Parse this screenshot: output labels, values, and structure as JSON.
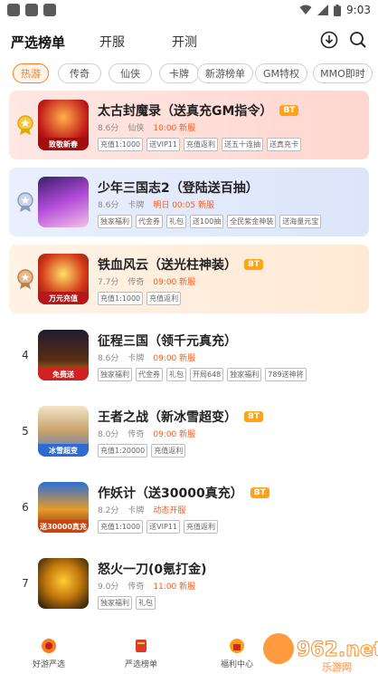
{
  "status_bar": {
    "time": "9:03"
  },
  "header": {
    "tabs": [
      {
        "label": "严选榜单",
        "active": true
      },
      {
        "label": "开服",
        "active": false
      },
      {
        "label": "开测",
        "active": false
      }
    ],
    "icons": [
      "download-icon",
      "search-icon"
    ]
  },
  "filters": [
    {
      "label": "热游",
      "active": true
    },
    {
      "label": "传奇",
      "active": false
    },
    {
      "label": "仙侠",
      "active": false
    },
    {
      "label": "卡牌",
      "active": false
    },
    {
      "label": "新游榜单",
      "active": false
    },
    {
      "label": "GM特权",
      "active": false
    },
    {
      "label": "MMO即时",
      "active": false
    }
  ],
  "games": [
    {
      "rank": "",
      "medal": "gold",
      "title": "太古封魔录（送真充GM指令）",
      "bt": "BT",
      "score": "8.6分",
      "genre": "仙侠",
      "time": "10:00 新服",
      "tags": [
        "充值1:1000",
        "送VIP11",
        "充值返利",
        "送五十连抽",
        "送真充卡"
      ],
      "thumb_caption": "致敬新春"
    },
    {
      "rank": "",
      "medal": "silver",
      "title": "少年三国志2（登陆送百抽）",
      "bt": "",
      "score": "8.6分",
      "genre": "卡牌",
      "time": "明日 00:05 新服",
      "tags": [
        "独家福利",
        "代金券",
        "礼包",
        "送100抽",
        "全民紫金神装",
        "送海量元宝"
      ],
      "thumb_caption": ""
    },
    {
      "rank": "",
      "medal": "bronze",
      "title": "铁血风云（送光柱神装）",
      "bt": "BT",
      "score": "7.7分",
      "genre": "传奇",
      "time": "09:00 新服",
      "tags": [
        "充值1:1000",
        "充值返利"
      ],
      "thumb_caption": "万元充值"
    },
    {
      "rank": "4",
      "medal": "",
      "title": "征程三国（领千元真充）",
      "bt": "",
      "score": "8.6分",
      "genre": "卡牌",
      "time": "09:00 新服",
      "tags": [
        "独家福利",
        "代金券",
        "礼包",
        "开局648",
        "独家福利",
        "789送神将"
      ],
      "thumb_caption": "免费送"
    },
    {
      "rank": "5",
      "medal": "",
      "title": "王者之战（新冰雪超变）",
      "bt": "BT",
      "score": "8.0分",
      "genre": "传奇",
      "time": "09:00 新服",
      "tags": [
        "充值1:20000",
        "充值返利"
      ],
      "thumb_caption": "冰雪超变"
    },
    {
      "rank": "6",
      "medal": "",
      "title": "作妖计（送30000真充）",
      "bt": "BT",
      "score": "8.2分",
      "genre": "卡牌",
      "time": "动态开服",
      "tags": [
        "充值1:1000",
        "送VIP11",
        "充值返利"
      ],
      "thumb_caption": "送30000真充"
    },
    {
      "rank": "7",
      "medal": "",
      "title": "怒火一刀(0氪打金)",
      "bt": "",
      "score": "9.0分",
      "genre": "传奇",
      "time": "11:00 新服",
      "tags": [
        "独家福利",
        "礼包"
      ],
      "thumb_caption": ""
    }
  ],
  "bottom_nav": [
    {
      "label": "好游严选",
      "icon": "home-icon"
    },
    {
      "label": "严选榜单",
      "icon": "ranking-icon"
    },
    {
      "label": "福利中心",
      "icon": "gift-icon"
    }
  ],
  "watermark": {
    "text": "962.net",
    "sub": "乐游网"
  },
  "colors": {
    "accent": "#ff7a1a",
    "card_gold": "#ffe3e0",
    "card_silver": "#e5ecfb",
    "card_bronze": "#fff1e3"
  }
}
